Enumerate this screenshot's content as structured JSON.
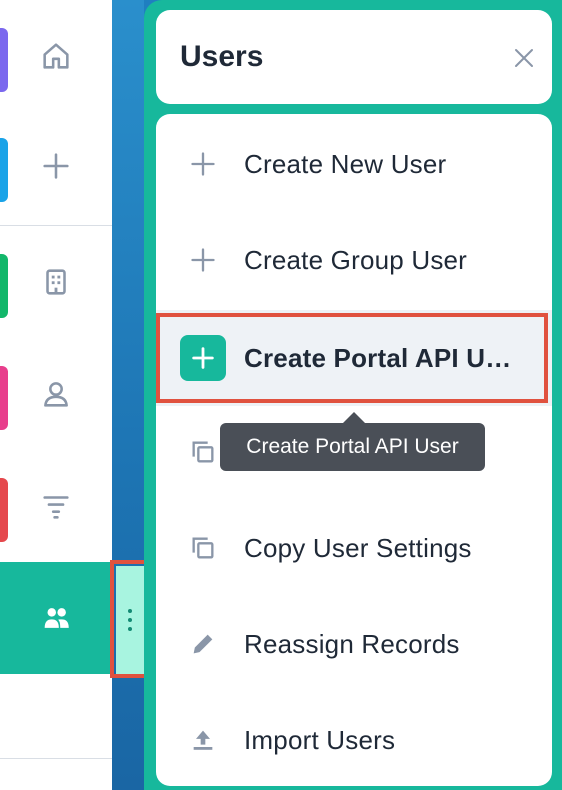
{
  "rail": {
    "items": [
      {
        "icon": "home-icon",
        "accent": "#7b68ee"
      },
      {
        "icon": "plus-icon",
        "accent": "#1aa3e8"
      },
      {
        "icon": "building-icon",
        "accent": "#12b76a"
      },
      {
        "icon": "person-icon",
        "accent": "#e83e8c"
      },
      {
        "icon": "filter-icon",
        "accent": "#e5484d"
      },
      {
        "icon": "users-icon",
        "accent": "#17b89c"
      }
    ]
  },
  "panel": {
    "title": "Users",
    "close_icon": "close-icon",
    "menu": [
      {
        "label": "Create New User",
        "icon": "plus-icon"
      },
      {
        "label": "Create Group User",
        "icon": "plus-icon"
      },
      {
        "label": "Create Portal API User",
        "icon": "plus-icon",
        "selected": true
      },
      {
        "label": "",
        "icon": "copy-icon"
      },
      {
        "label": "Copy User Settings",
        "icon": "copy-icon"
      },
      {
        "label": "Reassign Records",
        "icon": "pencil-icon"
      },
      {
        "label": "Import Users",
        "icon": "upload-icon"
      }
    ]
  },
  "tooltip": {
    "text": "Create Portal API User"
  },
  "colors": {
    "accent": "#17b89c",
    "highlight": "#e0523f"
  }
}
